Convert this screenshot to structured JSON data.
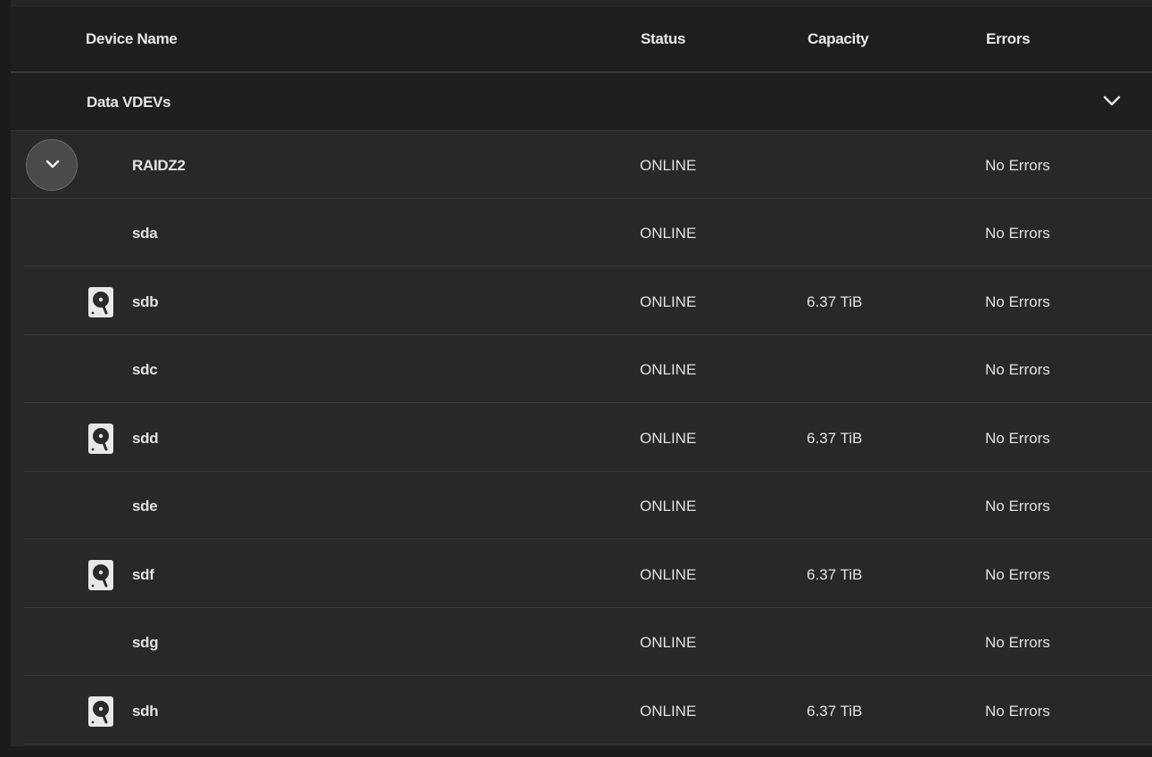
{
  "header": {
    "device_name": "Device Name",
    "status": "Status",
    "capacity": "Capacity",
    "errors": "Errors"
  },
  "group": {
    "title": "Data VDEVs",
    "chevron_icon": "chevron-down-icon"
  },
  "vdev": {
    "name": "RAIDZ2",
    "status": "ONLINE",
    "capacity": "",
    "errors": "No Errors",
    "expand_icon": "chevron-down-icon"
  },
  "disks": [
    {
      "name": "sda",
      "status": "ONLINE",
      "capacity": "",
      "errors": "No Errors",
      "icon": ""
    },
    {
      "name": "sdb",
      "status": "ONLINE",
      "capacity": "6.37 TiB",
      "errors": "No Errors",
      "icon": "hard-disk-icon"
    },
    {
      "name": "sdc",
      "status": "ONLINE",
      "capacity": "",
      "errors": "No Errors",
      "icon": ""
    },
    {
      "name": "sdd",
      "status": "ONLINE",
      "capacity": "6.37 TiB",
      "errors": "No Errors",
      "icon": "hard-disk-icon"
    },
    {
      "name": "sde",
      "status": "ONLINE",
      "capacity": "",
      "errors": "No Errors",
      "icon": ""
    },
    {
      "name": "sdf",
      "status": "ONLINE",
      "capacity": "6.37 TiB",
      "errors": "No Errors",
      "icon": "hard-disk-icon"
    },
    {
      "name": "sdg",
      "status": "ONLINE",
      "capacity": "",
      "errors": "No Errors",
      "icon": ""
    },
    {
      "name": "sdh",
      "status": "ONLINE",
      "capacity": "6.37 TiB",
      "errors": "No Errors",
      "icon": "hard-disk-icon"
    }
  ],
  "colors": {
    "background": "#1b1b1b",
    "panel": "#282828",
    "header": "#1e1e1e",
    "text": "#e6e6e6"
  }
}
